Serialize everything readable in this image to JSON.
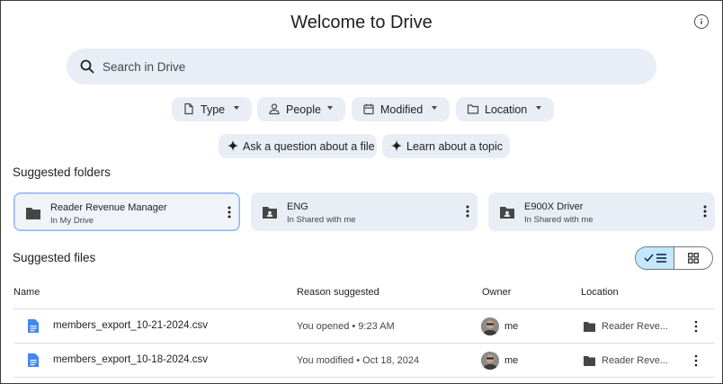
{
  "title": "Welcome to Drive",
  "search": {
    "placeholder": "Search in Drive"
  },
  "filters": [
    {
      "label": "Type",
      "icon": "file-icon"
    },
    {
      "label": "People",
      "icon": "person-icon"
    },
    {
      "label": "Modified",
      "icon": "calendar-icon"
    },
    {
      "label": "Location",
      "icon": "folder-icon"
    }
  ],
  "suggestions": [
    {
      "label": "Ask a question about a file"
    },
    {
      "label": "Learn about a topic"
    }
  ],
  "suggested_folders": {
    "title": "Suggested folders",
    "items": [
      {
        "name": "Reader Revenue Manager",
        "location": "In My Drive",
        "selected": true
      },
      {
        "name": "ENG",
        "location": "In Shared with me",
        "selected": false
      },
      {
        "name": "E900X Driver",
        "location": "In Shared with me",
        "selected": false
      }
    ]
  },
  "suggested_files": {
    "title": "Suggested files",
    "columns": {
      "name": "Name",
      "reason": "Reason suggested",
      "owner": "Owner",
      "location": "Location"
    },
    "rows": [
      {
        "name": "members_export_10-21-2024.csv",
        "reason": "You opened • 9:23 AM",
        "owner": "me",
        "location": "Reader Reve..."
      },
      {
        "name": "members_export_10-18-2024.csv",
        "reason": "You modified • Oct 18, 2024",
        "owner": "me",
        "location": "Reader Reve..."
      }
    ]
  },
  "colors": {
    "chip_bg": "#e9eef6",
    "toggle_active": "#c2e7ff",
    "doc_icon": "#4285f4"
  }
}
